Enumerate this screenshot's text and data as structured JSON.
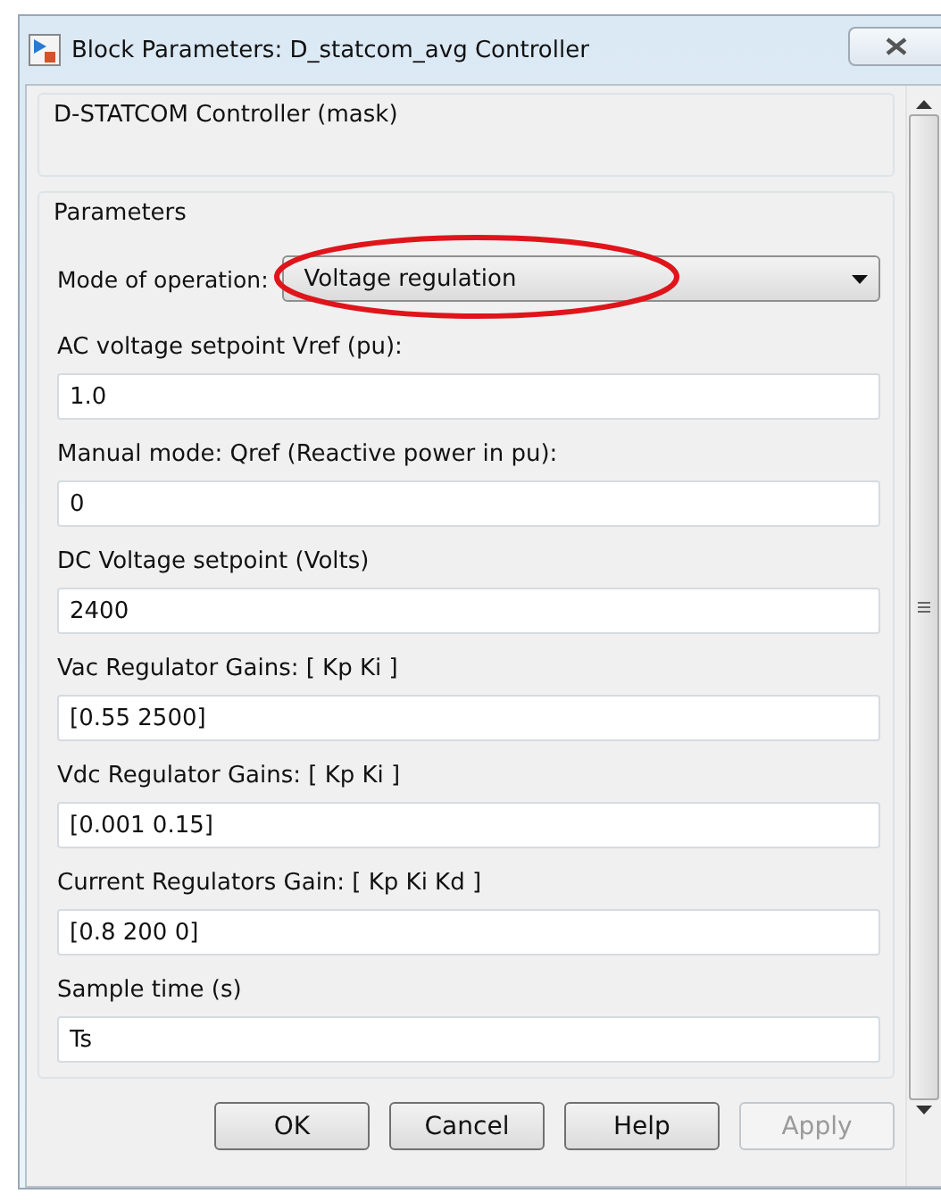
{
  "window": {
    "title": "Block Parameters: D_statcom_avg Controller"
  },
  "mask_title": "D-STATCOM Controller (mask)",
  "parameters": {
    "heading": "Parameters",
    "mode": {
      "label": "Mode of operation:",
      "value": "Voltage regulation",
      "highlighted": true
    },
    "fields": [
      {
        "label": "AC voltage setpoint Vref (pu):",
        "value": "1.0"
      },
      {
        "label": "Manual mode: Qref (Reactive power in pu):",
        "value": "0"
      },
      {
        "label": "DC Voltage setpoint (Volts)",
        "value": "2400"
      },
      {
        "label": "Vac Regulator Gains: [ Kp  Ki ]",
        "value": "[0.55 2500]"
      },
      {
        "label": "Vdc Regulator Gains: [ Kp  Ki ]",
        "value": "[0.001 0.15]"
      },
      {
        "label": "Current Regulators Gain: [ Kp Ki Kd ]",
        "value": "[0.8 200 0]"
      },
      {
        "label": "Sample time (s)",
        "value": "Ts"
      }
    ]
  },
  "buttons": [
    {
      "label": "OK",
      "disabled": false
    },
    {
      "label": "Cancel",
      "disabled": false
    },
    {
      "label": "Help",
      "disabled": false
    },
    {
      "label": "Apply",
      "disabled": true
    }
  ]
}
